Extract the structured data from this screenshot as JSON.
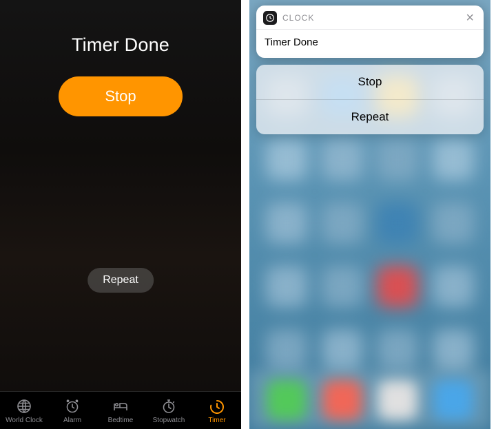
{
  "left": {
    "title": "Timer Done",
    "stop_label": "Stop",
    "repeat_label": "Repeat",
    "tabs": [
      {
        "label": "World Clock",
        "icon": "globe-icon"
      },
      {
        "label": "Alarm",
        "icon": "alarm-icon"
      },
      {
        "label": "Bedtime",
        "icon": "bed-icon"
      },
      {
        "label": "Stopwatch",
        "icon": "stopwatch-icon"
      },
      {
        "label": "Timer",
        "icon": "timer-icon"
      }
    ],
    "active_tab_index": 4
  },
  "right": {
    "notification": {
      "app_name": "CLOCK",
      "message": "Timer Done",
      "actions": {
        "stop": "Stop",
        "repeat": "Repeat"
      }
    }
  },
  "colors": {
    "accent_orange": "#ff9500"
  }
}
